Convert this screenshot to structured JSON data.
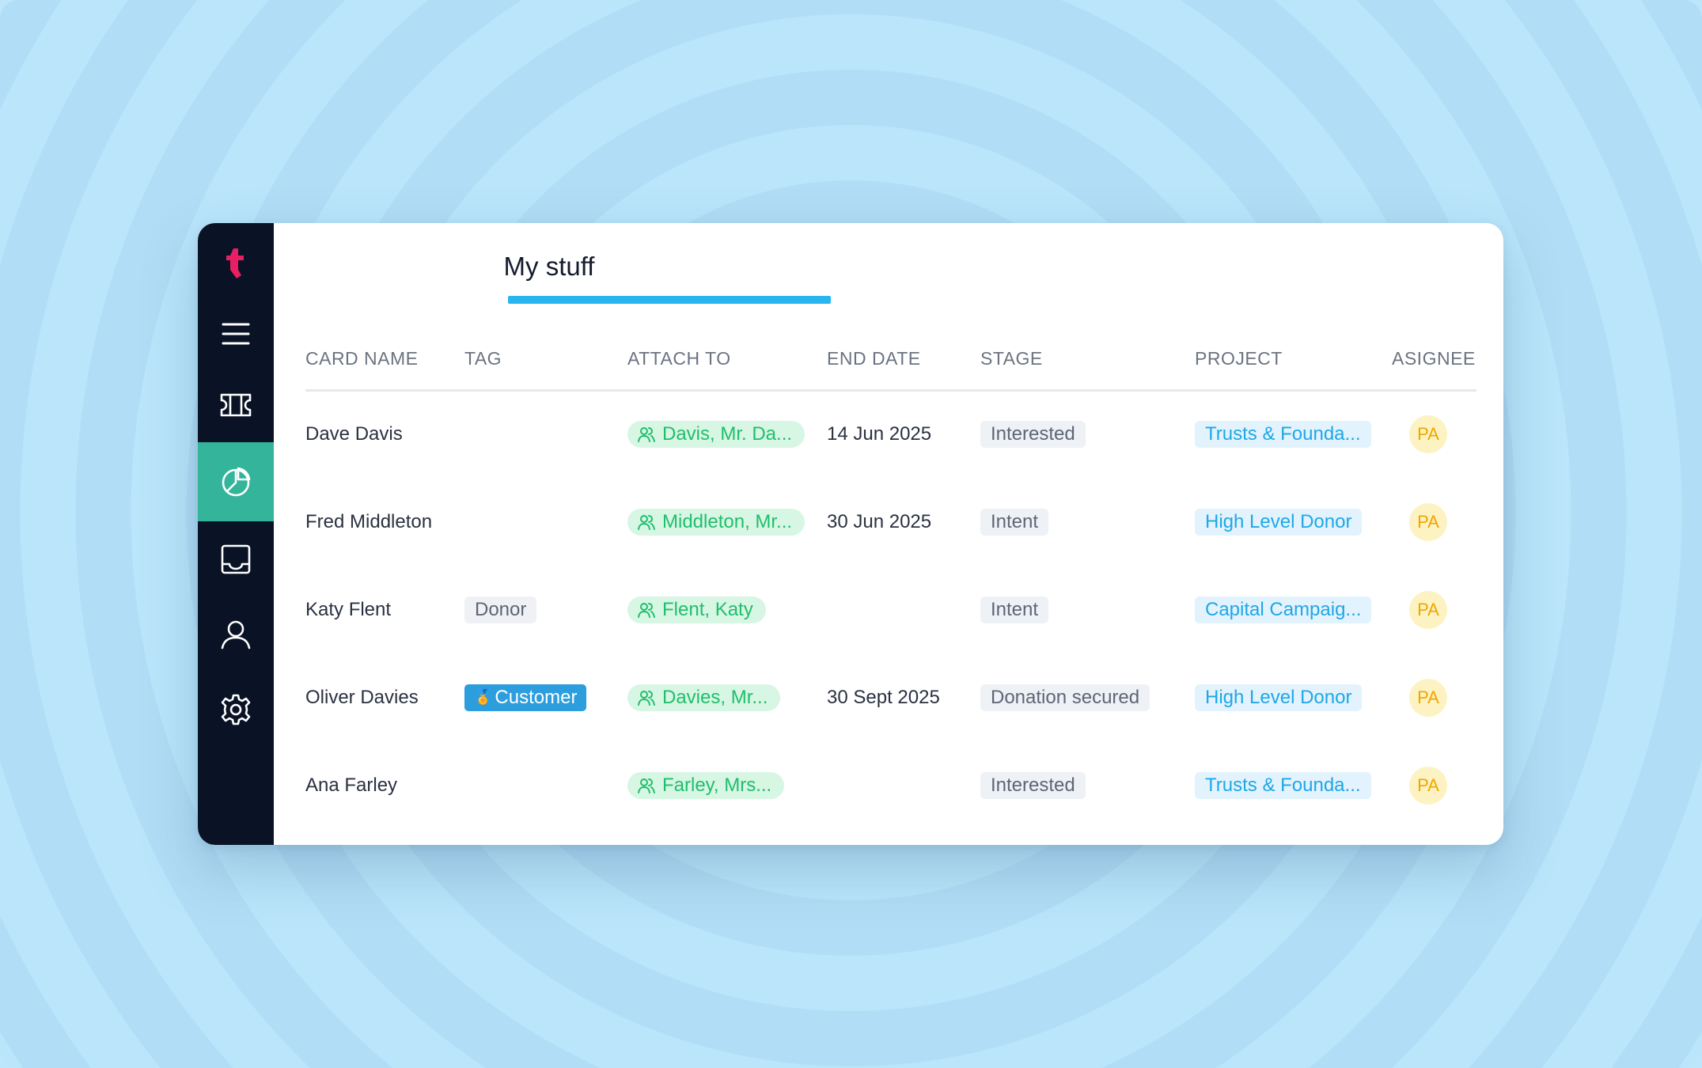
{
  "app": {
    "brand_color": "#e91e63",
    "active_color": "#33b49b"
  },
  "sidebar": {
    "items": [
      {
        "icon": "menu-icon"
      },
      {
        "icon": "ticket-icon"
      },
      {
        "icon": "pie-chart-icon",
        "active": true
      },
      {
        "icon": "inbox-icon"
      },
      {
        "icon": "user-icon"
      },
      {
        "icon": "gear-icon"
      }
    ]
  },
  "tab": {
    "title": "My stuff"
  },
  "table": {
    "headers": [
      "CARD NAME",
      "TAG",
      "ATTACH TO",
      "END DATE",
      "STAGE",
      "PROJECT",
      "ASIGNEE"
    ],
    "rows": [
      {
        "card_name": "Dave Davis",
        "tag": "",
        "attach_to": "Davis, Mr. Da...",
        "end_date": "14 Jun 2025",
        "stage": "Interested",
        "project": "Trusts & Founda...",
        "assignee": "PA"
      },
      {
        "card_name": "Fred Middleton",
        "tag": "",
        "attach_to": "Middleton, Mr...",
        "end_date": "30 Jun 2025",
        "stage": "Intent",
        "project": "High Level Donor",
        "assignee": "PA"
      },
      {
        "card_name": "Katy Flent",
        "tag": "Donor",
        "attach_to": "Flent, Katy",
        "end_date": "",
        "stage": "Intent",
        "project": "Capital Campaig...",
        "assignee": "PA"
      },
      {
        "card_name": "Oliver Davies",
        "tag": "Customer",
        "tag_icon": "medal-icon",
        "attach_to": "Davies, Mr...",
        "end_date": "30 Sept 2025",
        "stage": "Donation secured",
        "project": "High Level Donor",
        "assignee": "PA"
      },
      {
        "card_name": "Ana Farley",
        "tag": "",
        "attach_to": "Farley, Mrs...",
        "end_date": "",
        "stage": "Interested",
        "project": "Trusts & Founda...",
        "assignee": "PA"
      }
    ]
  }
}
